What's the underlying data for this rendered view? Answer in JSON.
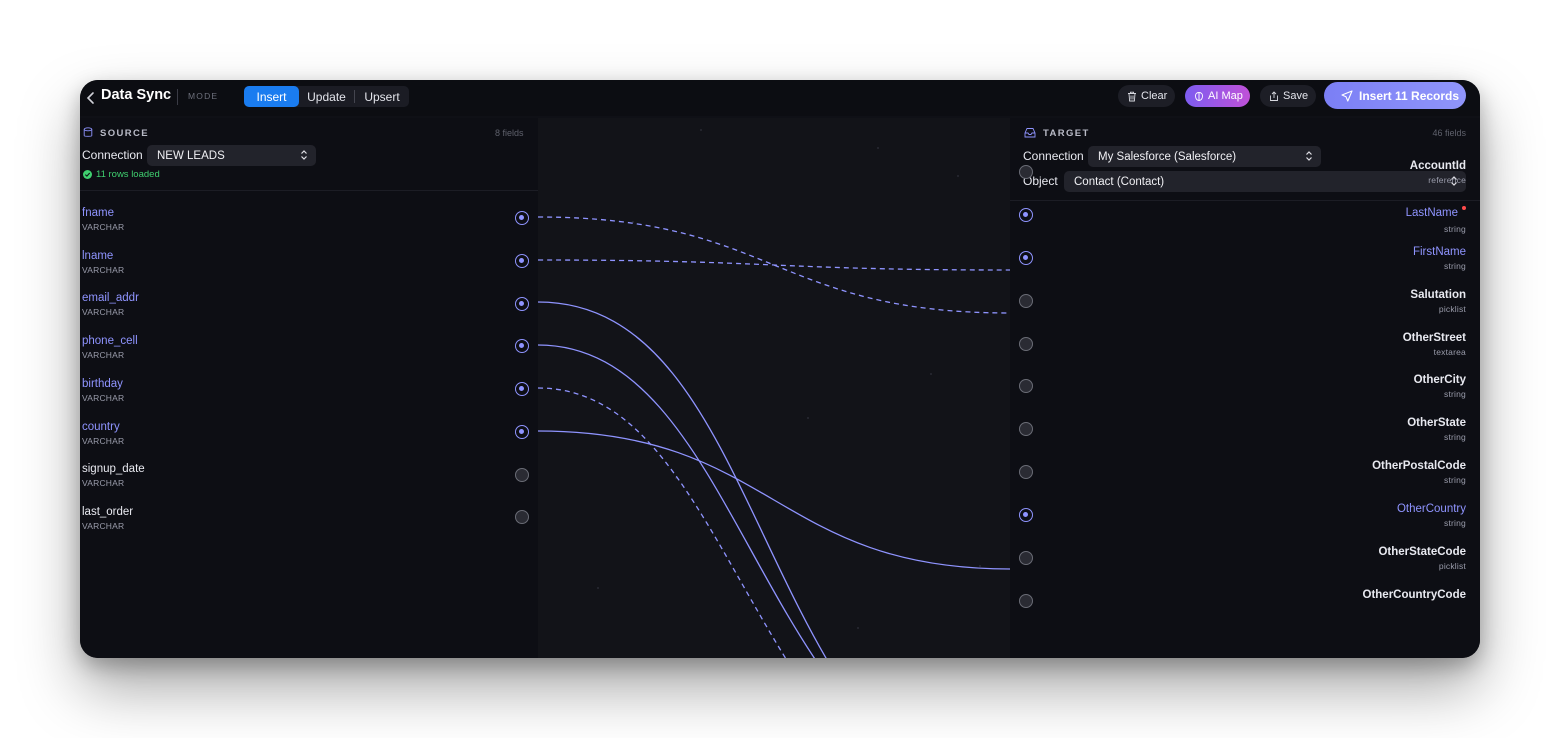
{
  "header": {
    "title": "Data Sync",
    "mode_label": "MODE",
    "modes": [
      "Insert",
      "Update",
      "Upsert"
    ],
    "active_mode": "Insert",
    "clear_label": "Clear",
    "ai_map_label": "AI Map",
    "save_label": "Save",
    "insert_label": "Insert 11 Records"
  },
  "source": {
    "label": "SOURCE",
    "field_count": "8 fields",
    "connection_label": "Connection",
    "connection_value": "NEW LEADS",
    "status": "11 rows loaded",
    "fields": [
      {
        "name": "fname",
        "type": "VARCHAR",
        "mapped": true
      },
      {
        "name": "lname",
        "type": "VARCHAR",
        "mapped": true
      },
      {
        "name": "email_addr",
        "type": "VARCHAR",
        "mapped": true
      },
      {
        "name": "phone_cell",
        "type": "VARCHAR",
        "mapped": true
      },
      {
        "name": "birthday",
        "type": "VARCHAR",
        "mapped": true
      },
      {
        "name": "country",
        "type": "VARCHAR",
        "mapped": true
      },
      {
        "name": "signup_date",
        "type": "VARCHAR",
        "mapped": false
      },
      {
        "name": "last_order",
        "type": "VARCHAR",
        "mapped": false
      }
    ]
  },
  "target": {
    "label": "TARGET",
    "field_count": "46 fields",
    "connection_label": "Connection",
    "connection_value": "My Salesforce (Salesforce)",
    "object_label": "Object",
    "object_value": "Contact (Contact)",
    "fields": [
      {
        "name": "AccountId",
        "type": "reference",
        "mapped": false,
        "required": false
      },
      {
        "name": "LastName",
        "type": "string",
        "mapped": true,
        "required": true
      },
      {
        "name": "FirstName",
        "type": "string",
        "mapped": true,
        "required": false
      },
      {
        "name": "Salutation",
        "type": "picklist",
        "mapped": false,
        "required": false
      },
      {
        "name": "OtherStreet",
        "type": "textarea",
        "mapped": false,
        "required": false
      },
      {
        "name": "OtherCity",
        "type": "string",
        "mapped": false,
        "required": false
      },
      {
        "name": "OtherState",
        "type": "string",
        "mapped": false,
        "required": false
      },
      {
        "name": "OtherPostalCode",
        "type": "string",
        "mapped": false,
        "required": false
      },
      {
        "name": "OtherCountry",
        "type": "string",
        "mapped": true,
        "required": false
      },
      {
        "name": "OtherStateCode",
        "type": "picklist",
        "mapped": false,
        "required": false
      },
      {
        "name": "OtherCountryCode",
        "type": "",
        "mapped": false,
        "required": false
      }
    ]
  },
  "mappings": [
    {
      "source": "fname",
      "target": "FirstName",
      "style": "dashed"
    },
    {
      "source": "lname",
      "target": "LastName",
      "style": "dashed"
    },
    {
      "source": "email_addr",
      "target_index": 15,
      "style": "solid"
    },
    {
      "source": "phone_cell",
      "target_index": 14,
      "style": "solid"
    },
    {
      "source": "birthday",
      "target_index": 13,
      "style": "dashed"
    },
    {
      "source": "country",
      "target": "OtherCountry",
      "style": "solid"
    }
  ],
  "colors": {
    "accent": "#8f94ff",
    "primary_button": "#1a7cf0",
    "success": "#3fcf6f",
    "required": "#ff4b4b"
  }
}
